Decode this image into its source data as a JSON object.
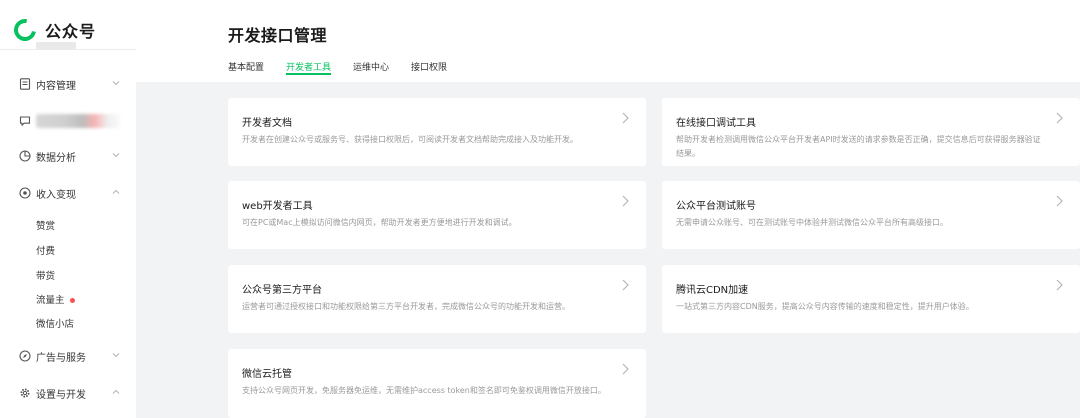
{
  "brand": {
    "name": "公众号",
    "color": "#07c160"
  },
  "nav": {
    "content_mgmt": "内容管理",
    "data_analysis": "数据分析",
    "monetize": "收入变现",
    "ads_service": "广告与服务",
    "settings_dev": "设置与开发"
  },
  "monetize_sub": [
    "赞赏",
    "付费",
    "带货",
    "流量主",
    "微信小店"
  ],
  "page": {
    "title": "开发接口管理",
    "tabs": [
      "基本配置",
      "开发者工具",
      "运维中心",
      "接口权限"
    ],
    "active_tab": "开发者工具"
  },
  "cards": [
    {
      "title": "开发者文档",
      "desc": "开发者在创建公众号或服务号、获得接口权限后，可阅读开发者文档帮助完成接入及功能开发。"
    },
    {
      "title": "在线接口调试工具",
      "desc": "帮助开发者检测调用微信公众平台开发者API时发送的请求参数是否正确，提交信息后可获得服务器验证结果。"
    },
    {
      "title": "web开发者工具",
      "desc": "可在PC或Mac上模拟访问微信内网页，帮助开发者更方便地进行开发和调试。"
    },
    {
      "title": "公众平台测试账号",
      "desc": "无需申请公众账号、可在测试账号中体验并测试微信公众平台所有高级接口。"
    },
    {
      "title": "公众号第三方平台",
      "desc": "运营者可通过授权接口和功能权限给第三方平台开发者，完成微信公众号的功能开发和运营。"
    },
    {
      "title": "腾讯云CDN加速",
      "desc": "一站式第三方内容CDN服务，提高公众号内容传输的速度和稳定性，提升用户体验。"
    },
    {
      "title": "微信云托管",
      "desc": "支持公众号网页开发，免服务器免运维，无需维护access token和签名即可免鉴权调用微信开放接口。"
    }
  ],
  "colors": {
    "accent": "#07c160",
    "badge": "#fa5151",
    "text": "#353535",
    "muted": "#9a9a9a",
    "background": "#f2f3f5"
  }
}
